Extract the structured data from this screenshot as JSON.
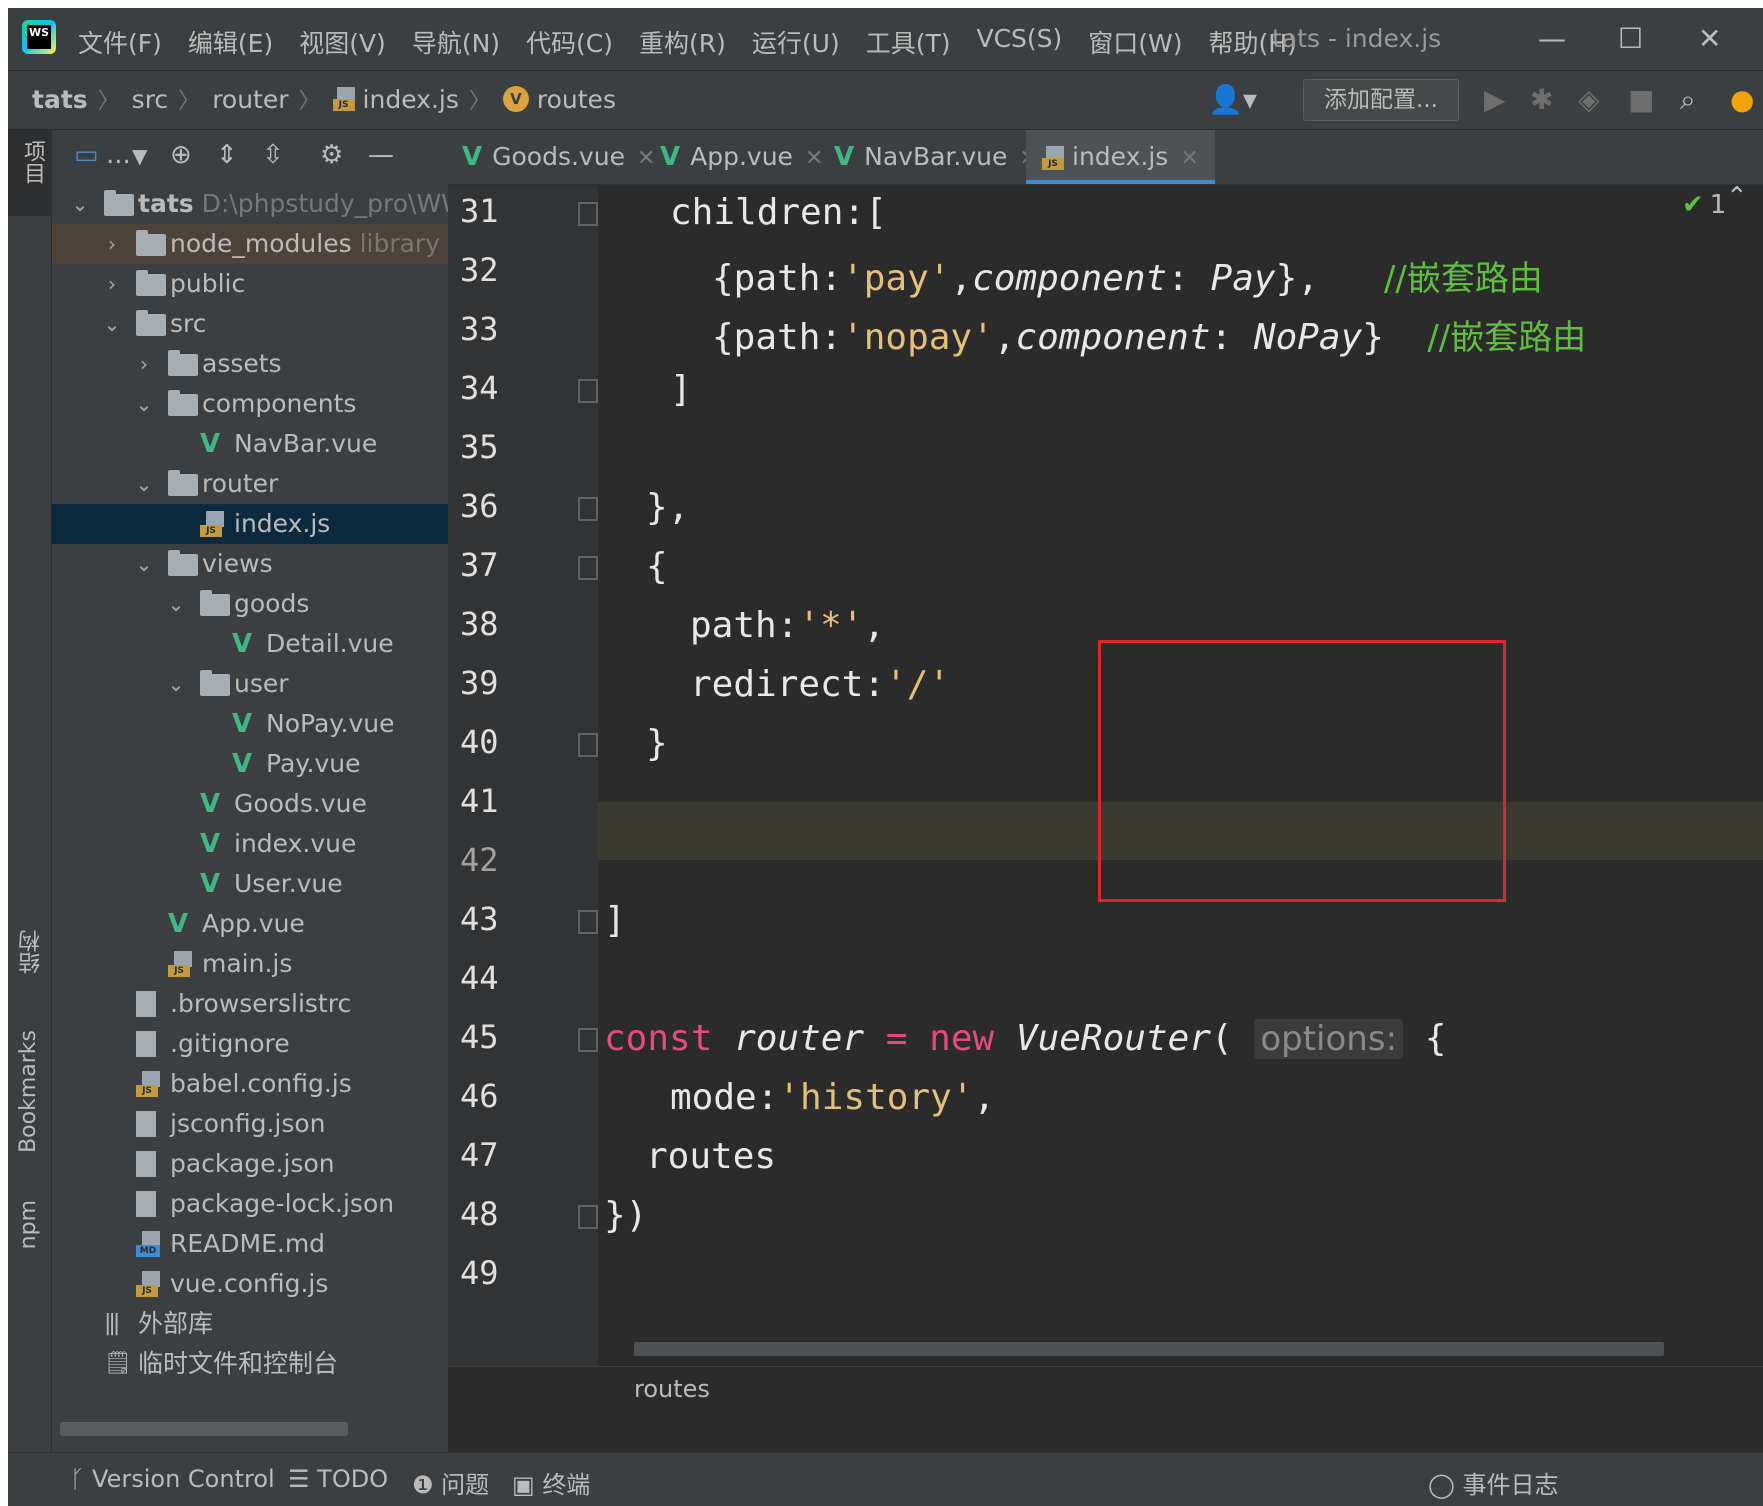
{
  "app": {
    "logo_text": "WS",
    "window_title": "tats - index.js",
    "menu": [
      "文件(F)",
      "编辑(E)",
      "视图(V)",
      "导航(N)",
      "代码(C)",
      "重构(R)",
      "运行(U)",
      "工具(T)",
      "VCS(S)",
      "窗口(W)",
      "帮助(H)"
    ],
    "window_controls": {
      "minimize": "—",
      "maximize": "☐",
      "close": "✕"
    }
  },
  "navbar": {
    "breadcrumbs": [
      "tats",
      "src",
      "router",
      "index.js",
      "routes"
    ],
    "routes_badge": "V",
    "add_config_label": "添加配置...",
    "icons": [
      "user-icon",
      "run-icon",
      "debug-icon",
      "coverage-icon",
      "stop-icon",
      "search-icon",
      "update-icon"
    ]
  },
  "left_strip": {
    "project_tab": "项目",
    "structure_tab": "结构",
    "bookmarks_tab": "Bookmarks",
    "npm_tab": "npm"
  },
  "project_panel": {
    "toolbar_dots": "...",
    "tree": [
      {
        "label": "tats",
        "hint": "D:\\phpstudy_pro\\WW",
        "type": "folder",
        "depth": 0,
        "expanded": true,
        "bold": true
      },
      {
        "label": "node_modules",
        "hint": "library r",
        "type": "folder",
        "depth": 1,
        "expanded": false,
        "highlight": true
      },
      {
        "label": "public",
        "type": "folder",
        "depth": 1,
        "expanded": false
      },
      {
        "label": "src",
        "type": "folder",
        "depth": 1,
        "expanded": true
      },
      {
        "label": "assets",
        "type": "folder",
        "depth": 2,
        "expanded": false
      },
      {
        "label": "components",
        "type": "folder",
        "depth": 2,
        "expanded": true
      },
      {
        "label": "NavBar.vue",
        "type": "vue",
        "depth": 3
      },
      {
        "label": "router",
        "type": "folder",
        "depth": 2,
        "expanded": true
      },
      {
        "label": "index.js",
        "type": "js",
        "depth": 3,
        "selected": true
      },
      {
        "label": "views",
        "type": "folder",
        "depth": 2,
        "expanded": true
      },
      {
        "label": "goods",
        "type": "folder",
        "depth": 3,
        "expanded": true
      },
      {
        "label": "Detail.vue",
        "type": "vue",
        "depth": 4
      },
      {
        "label": "user",
        "type": "folder",
        "depth": 3,
        "expanded": true
      },
      {
        "label": "NoPay.vue",
        "type": "vue",
        "depth": 4
      },
      {
        "label": "Pay.vue",
        "type": "vue",
        "depth": 4
      },
      {
        "label": "Goods.vue",
        "type": "vue",
        "depth": 3
      },
      {
        "label": "index.vue",
        "type": "vue",
        "depth": 3
      },
      {
        "label": "User.vue",
        "type": "vue",
        "depth": 3
      },
      {
        "label": "App.vue",
        "type": "vue",
        "depth": 2
      },
      {
        "label": "main.js",
        "type": "js",
        "depth": 2
      },
      {
        "label": ".browserslistrc",
        "type": "file",
        "depth": 1
      },
      {
        "label": ".gitignore",
        "type": "file",
        "depth": 1
      },
      {
        "label": "babel.config.js",
        "type": "js",
        "depth": 1
      },
      {
        "label": "jsconfig.json",
        "type": "file",
        "depth": 1
      },
      {
        "label": "package.json",
        "type": "file",
        "depth": 1
      },
      {
        "label": "package-lock.json",
        "type": "file",
        "depth": 1
      },
      {
        "label": "README.md",
        "type": "md",
        "depth": 1
      },
      {
        "label": "vue.config.js",
        "type": "js",
        "depth": 1
      },
      {
        "label": "外部库",
        "type": "lib",
        "depth": 0
      },
      {
        "label": "临时文件和控制台",
        "type": "scratch",
        "depth": 0
      }
    ]
  },
  "editor": {
    "tabs": [
      {
        "label": "Goods.vue",
        "type": "vue",
        "active": false
      },
      {
        "label": "App.vue",
        "type": "vue",
        "active": false
      },
      {
        "label": "NavBar.vue",
        "type": "vue",
        "active": false
      },
      {
        "label": "index.js",
        "type": "js",
        "active": true
      }
    ],
    "inspection_count": "1",
    "line_numbers": [
      "31",
      "32",
      "33",
      "34",
      "35",
      "36",
      "37",
      "38",
      "39",
      "40",
      "41",
      "42",
      "43",
      "44",
      "45",
      "46",
      "47",
      "48",
      "49"
    ],
    "code": {
      "l31": "children:[",
      "l32_a": "{path:",
      "l32_str": "'pay'",
      "l32_b": ",",
      "l32_comp": "component",
      "l32_c": ": ",
      "l32_val": "Pay",
      "l32_d": "},",
      "l32_cm": "//嵌套路由",
      "l33_a": "{path:",
      "l33_str": "'nopay'",
      "l33_b": ",",
      "l33_comp": "component",
      "l33_c": ": ",
      "l33_val": "NoPay",
      "l33_d": "}",
      "l33_cm": "//嵌套路由",
      "l34": "]",
      "l36": "},",
      "l37": "{",
      "l38_a": "path:",
      "l38_str": "'*'",
      "l38_b": ",",
      "l39_a": "redirect:",
      "l39_str": "'/'",
      "l40": "}",
      "l43": "]",
      "l45_kw": "const",
      "l45_var": "router",
      "l45_eq": "=",
      "l45_new": "new",
      "l45_cls": "VueRouter",
      "l45_paren": "(",
      "l45_hint": "options:",
      "l45_brace": "{",
      "l46_a": "mode:",
      "l46_str": "'history'",
      "l46_b": ",",
      "l47": "routes",
      "l48": "})"
    },
    "breadcrumb_status": "routes"
  },
  "bottom_bar": {
    "items": [
      {
        "icon": "branch-icon",
        "label": "Version Control"
      },
      {
        "icon": "list-icon",
        "label": "TODO"
      },
      {
        "icon": "warning-icon",
        "label": "问题"
      },
      {
        "icon": "terminal-icon",
        "label": "终端"
      }
    ],
    "event_log": "事件日志"
  },
  "colors": {
    "keyword": "#cc7832",
    "string": "#e5c07b",
    "comment": "#5fbf3f",
    "highlight_box": "#e0262d",
    "vue": "#41b883"
  }
}
